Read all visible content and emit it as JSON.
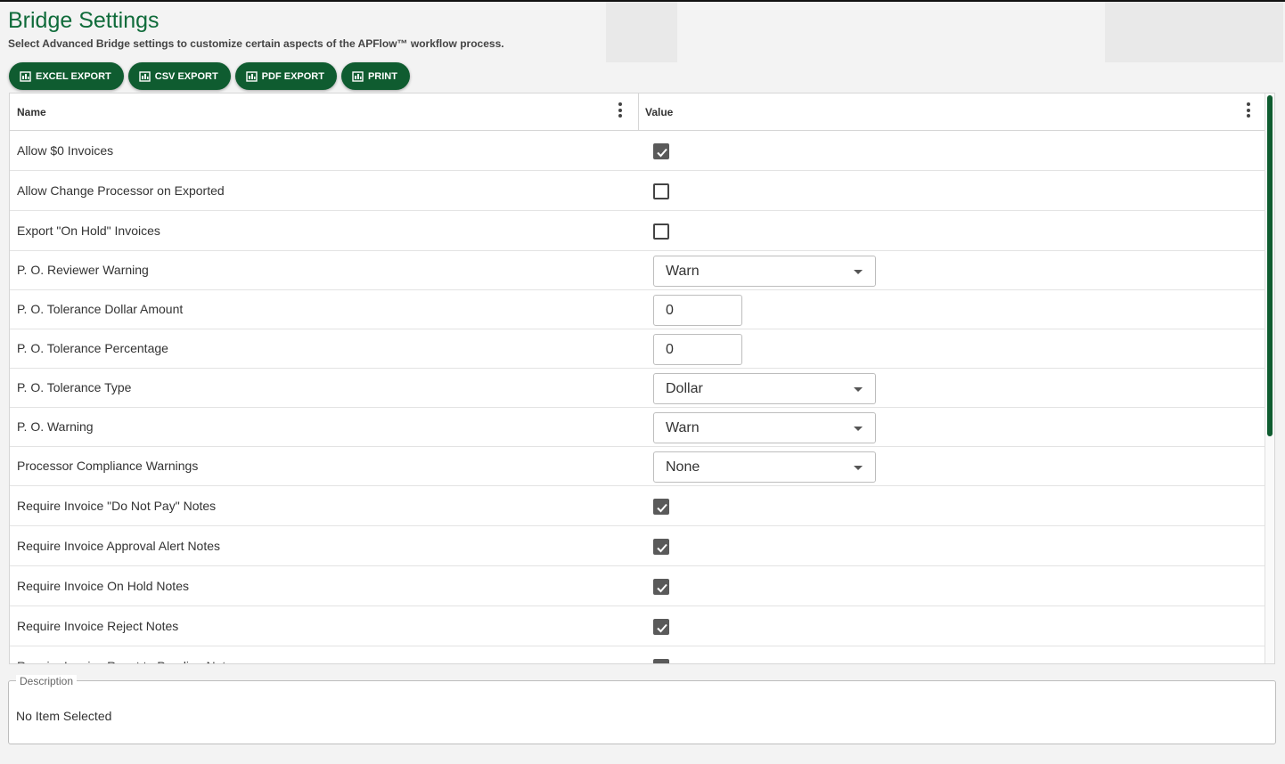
{
  "page": {
    "title": "Bridge Settings",
    "subtitle": "Select Advanced Bridge settings to customize certain aspects of the APFlow™ workflow process."
  },
  "toolbar": [
    {
      "label": "EXCEL EXPORT",
      "icon": "export-icon"
    },
    {
      "label": "CSV EXPORT",
      "icon": "export-icon"
    },
    {
      "label": "PDF EXPORT",
      "icon": "export-icon"
    },
    {
      "label": "PRINT",
      "icon": "print-icon"
    }
  ],
  "grid": {
    "columns": {
      "name": "Name",
      "value": "Value"
    },
    "rows": [
      {
        "name": "Allow $0 Invoices",
        "type": "checkbox",
        "checked": true
      },
      {
        "name": "Allow Change Processor on Exported",
        "type": "checkbox",
        "checked": false
      },
      {
        "name": "Export \"On Hold\" Invoices",
        "type": "checkbox",
        "checked": false
      },
      {
        "name": "P. O. Reviewer Warning",
        "type": "dropdown",
        "value": "Warn"
      },
      {
        "name": "P. O. Tolerance Dollar Amount",
        "type": "number",
        "value": "0"
      },
      {
        "name": "P. O. Tolerance Percentage",
        "type": "number",
        "value": "0"
      },
      {
        "name": "P. O. Tolerance Type",
        "type": "dropdown",
        "value": "Dollar"
      },
      {
        "name": "P. O. Warning",
        "type": "dropdown",
        "value": "Warn"
      },
      {
        "name": "Processor Compliance Warnings",
        "type": "dropdown",
        "value": "None"
      },
      {
        "name": "Require Invoice \"Do Not Pay\" Notes",
        "type": "checkbox",
        "checked": true
      },
      {
        "name": "Require Invoice Approval Alert Notes",
        "type": "checkbox",
        "checked": true
      },
      {
        "name": "Require Invoice On Hold Notes",
        "type": "checkbox",
        "checked": true
      },
      {
        "name": "Require Invoice Reject Notes",
        "type": "checkbox",
        "checked": true
      },
      {
        "name": "Require Invoice Reset to Pending Notes",
        "type": "checkbox",
        "checked": true
      }
    ]
  },
  "description": {
    "legend": "Description",
    "text": "No Item Selected"
  },
  "colors": {
    "brand_green": "#0f5c30",
    "title_green": "#0f6b3a"
  }
}
